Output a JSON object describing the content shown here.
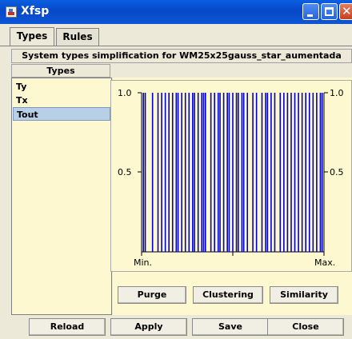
{
  "window": {
    "title": "Xfsp",
    "title_bar_color": "#0a5fe0"
  },
  "tabs": [
    {
      "label": "Types",
      "active": true
    },
    {
      "label": "Rules",
      "active": false
    }
  ],
  "header": {
    "title": "System types simplification for WM25x25gauss_star_aumentada"
  },
  "types_panel": {
    "header": "Types",
    "items": [
      {
        "label": "Ty",
        "selected": false
      },
      {
        "label": "Tx",
        "selected": false
      },
      {
        "label": "Tout",
        "selected": true
      }
    ]
  },
  "chart_data": {
    "type": "bar",
    "description": "Membership function plot for selected type: narrow vertical lines (singletons) of height 1.0",
    "x_tick_labels": [
      "Min.",
      "Max."
    ],
    "y_tick_labels_left": [
      "1.0",
      "0.5"
    ],
    "y_tick_labels_right": [
      "1.0",
      "0.5"
    ],
    "ylim": [
      0,
      1
    ],
    "xlim": [
      0,
      1
    ],
    "line_color": "#0000cc",
    "positions": [
      0.01,
      0.02,
      0.06,
      0.09,
      0.11,
      0.13,
      0.15,
      0.17,
      0.19,
      0.2,
      0.22,
      0.24,
      0.26,
      0.28,
      0.29,
      0.31,
      0.33,
      0.34,
      0.35,
      0.38,
      0.4,
      0.42,
      0.43,
      0.45,
      0.47,
      0.48,
      0.5,
      0.52,
      0.53,
      0.55,
      0.56,
      0.58,
      0.61,
      0.63,
      0.66,
      0.68,
      0.69,
      0.71,
      0.73,
      0.76,
      0.78,
      0.8,
      0.82,
      0.84,
      0.86,
      0.88,
      0.9,
      0.92,
      0.94,
      0.96,
      0.98,
      0.99
    ],
    "values": [
      1,
      1,
      1,
      1,
      1,
      1,
      1,
      1,
      1,
      1,
      1,
      1,
      1,
      1,
      1,
      1,
      1,
      1,
      1,
      1,
      1,
      1,
      1,
      1,
      1,
      1,
      1,
      1,
      1,
      1,
      1,
      1,
      1,
      1,
      1,
      1,
      1,
      1,
      1,
      1,
      1,
      1,
      1,
      1,
      1,
      1,
      1,
      1,
      1,
      1,
      1,
      1
    ]
  },
  "actions": {
    "purge": "Purge",
    "clustering": "Clustering",
    "similarity": "Similarity"
  },
  "bottom_buttons": {
    "reload": "Reload",
    "apply": "Apply",
    "save": "Save",
    "close": "Close"
  }
}
